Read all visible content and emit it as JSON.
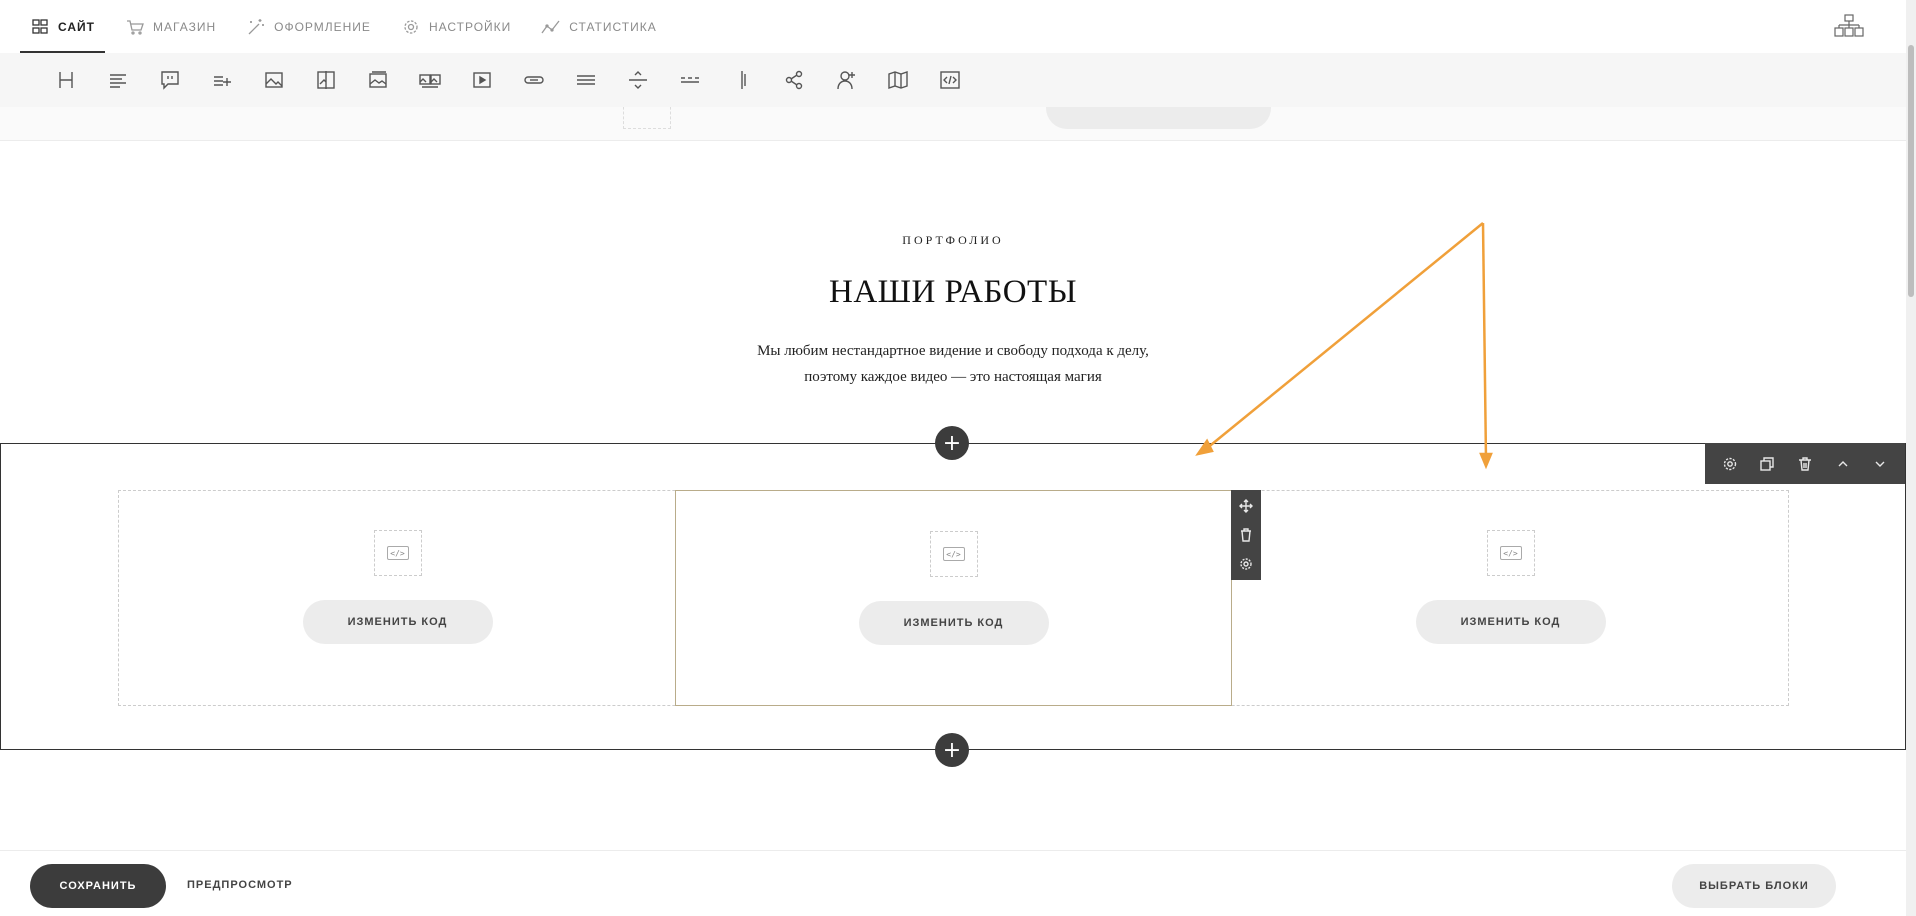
{
  "nav": {
    "items": [
      {
        "label": "САЙТ",
        "icon": "grid-icon",
        "active": true
      },
      {
        "label": "МАГАЗИН",
        "icon": "cart-icon"
      },
      {
        "label": "ОФОРМЛЕНИЕ",
        "icon": "magic-wand-icon"
      },
      {
        "label": "НАСТРОЙКИ",
        "icon": "gear-icon"
      },
      {
        "label": "СТАТИСТИКА",
        "icon": "line-chart-icon"
      }
    ],
    "right_icon": "sitemap-icon"
  },
  "toolbar": {
    "tools": [
      "heading-icon",
      "text-align-icon",
      "quote-icon",
      "list-add-icon",
      "image-icon",
      "image-compare-icon",
      "gallery-icon",
      "gallery-multi-icon",
      "video-icon",
      "button-icon",
      "lines-icon",
      "divider-icon",
      "dashed-divider-icon",
      "vertical-divider-icon",
      "share-icon",
      "add-person-icon",
      "map-icon",
      "code-icon"
    ]
  },
  "section": {
    "eyebrow": "ПОРТФОЛИО",
    "title": "НАШИ РАБОТЫ",
    "desc_line1": "Мы любим нестандартное видение и свободу подхода к делу,",
    "desc_line2": "поэтому каждое видео — это настоящая магия"
  },
  "block": {
    "columns": [
      {
        "button": "ИЗМЕНИТЬ КОД",
        "active": false
      },
      {
        "button": "ИЗМЕНИТЬ КОД",
        "active": true
      },
      {
        "button": "ИЗМЕНИТЬ КОД",
        "active": false
      }
    ],
    "add_symbol": "+",
    "code_symbol": "</>",
    "block_tools": [
      "gear-icon",
      "copy-icon",
      "trash-icon",
      "chevron-up-icon",
      "chevron-down-icon"
    ],
    "column_tools": [
      "move-icon",
      "trash-icon",
      "gear-icon"
    ]
  },
  "bottom": {
    "save": "СОХРАНИТЬ",
    "preview": "ПРЕДПРОСМОТР",
    "choose_blocks": "ВЫБРАТЬ БЛОКИ"
  },
  "annotation": {
    "arrow_color": "#F0A03A"
  }
}
